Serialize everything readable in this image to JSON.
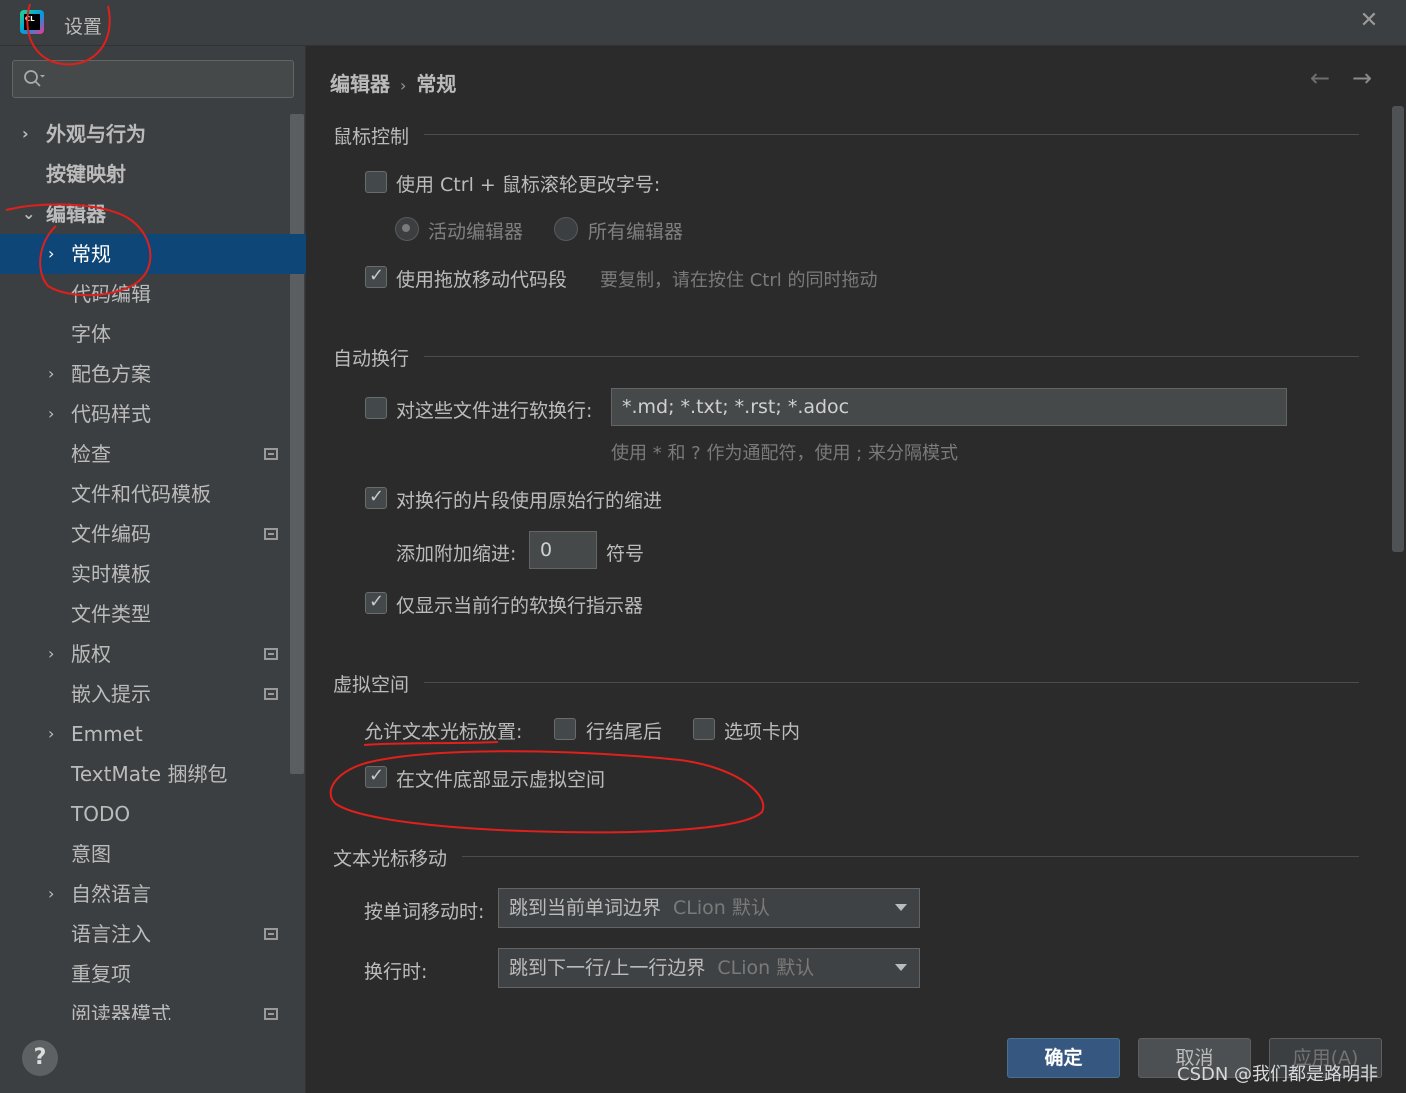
{
  "window": {
    "title": "设置"
  },
  "search": {
    "value": "",
    "placeholder": ""
  },
  "tree": [
    {
      "label": "外观与行为",
      "expand": ">"
    },
    {
      "label": "按键映射"
    },
    {
      "label": "编辑器",
      "expand": "v"
    },
    {
      "label": "常规",
      "expand": ">"
    },
    {
      "label": "代码编辑"
    },
    {
      "label": "字体"
    },
    {
      "label": "配色方案",
      "expand": ">"
    },
    {
      "label": "代码样式",
      "expand": ">"
    },
    {
      "label": "检查"
    },
    {
      "label": "文件和代码模板"
    },
    {
      "label": "文件编码"
    },
    {
      "label": "实时模板"
    },
    {
      "label": "文件类型"
    },
    {
      "label": "版权",
      "expand": ">"
    },
    {
      "label": "嵌入提示"
    },
    {
      "label": "Emmet",
      "expand": ">"
    },
    {
      "label": "TextMate 捆绑包"
    },
    {
      "label": "TODO"
    },
    {
      "label": "意图"
    },
    {
      "label": "自然语言",
      "expand": ">"
    },
    {
      "label": "语言注入"
    },
    {
      "label": "重复项"
    },
    {
      "label": "阅读器模式"
    }
  ],
  "breadcrumb": {
    "parent": "编辑器",
    "sep": "›",
    "current": "常规"
  },
  "nav": {
    "back": "←",
    "forward": "→"
  },
  "sections": {
    "mouse": {
      "title": "鼠标控制",
      "ctrl_wheel": "使用 Ctrl + 鼠标滚轮更改字号:",
      "radio_active": "活动编辑器",
      "radio_all": "所有编辑器",
      "drag_move": "使用拖放移动代码段",
      "drag_hint": "要复制，请在按住 Ctrl 的同时拖动"
    },
    "softwrap": {
      "title": "自动换行",
      "soft_wrap_files": "对这些文件进行软换行:",
      "files_value": "*.md; *.txt; *.rst; *.adoc",
      "files_hint": "使用 * 和 ? 作为通配符，使用 ; 来分隔模式",
      "use_indent": "对换行的片段使用原始行的缩进",
      "extra_indent_label": "添加附加缩进:",
      "extra_indent_value": "0",
      "extra_indent_unit": "符号",
      "current_line_only": "仅显示当前行的软换行指示器"
    },
    "virtual": {
      "title": "虚拟空间",
      "allow_caret": "允许文本光标放置:",
      "after_eol": "行结尾后",
      "inside_tabs": "选项卡内",
      "show_bottom": "在文件底部显示虚拟空间"
    },
    "caret": {
      "title": "文本光标移动",
      "word_move_label": "按单词移动时:",
      "word_move_value": "跳到当前单词边界",
      "word_move_default": "CLion 默认",
      "line_change_label": "换行时:",
      "line_change_value": "跳到下一行/上一行边界",
      "line_change_default": "CLion 默认"
    }
  },
  "buttons": {
    "ok": "确定",
    "cancel": "取消",
    "apply": "应用(A)",
    "help": "?"
  },
  "watermark": "CSDN @我们都是路明非",
  "app_icon_text": "CL"
}
